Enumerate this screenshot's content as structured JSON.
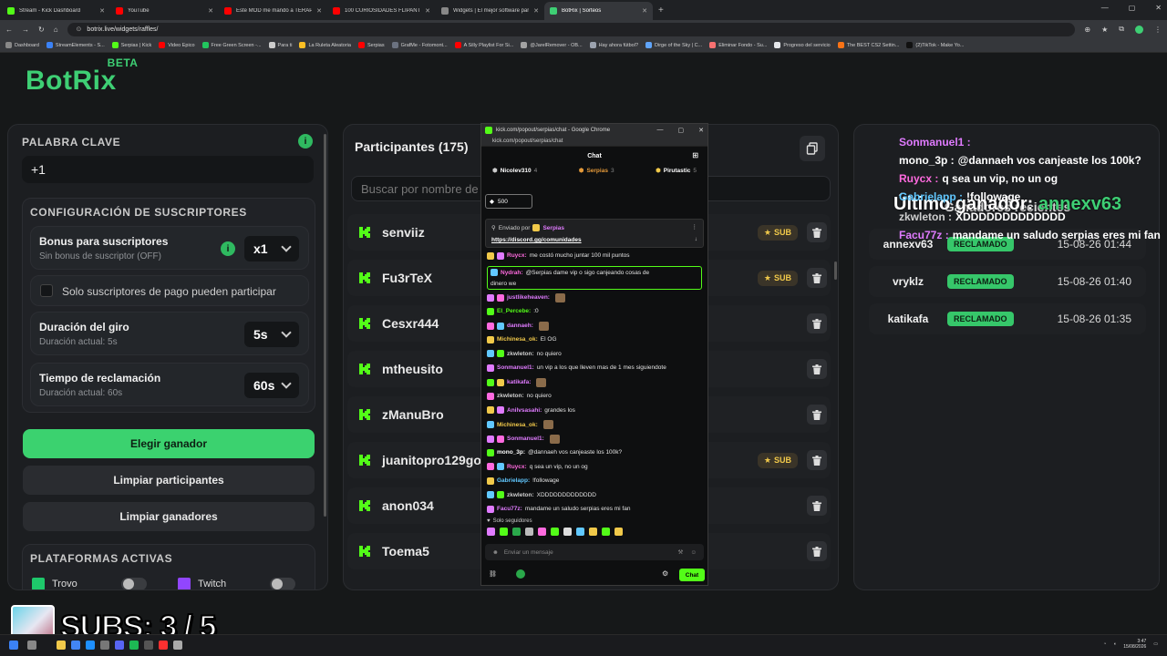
{
  "browser": {
    "tabs": [
      {
        "title": "Stream - Kick Dashboard",
        "color": "#53fc18"
      },
      {
        "title": "YouTube",
        "color": "#ff0000"
      },
      {
        "title": "Este MOD me mandó a TERAPIA",
        "color": "#ff0000"
      },
      {
        "title": "100 CURIOSIDADES FLIPANTES",
        "color": "#ff0000"
      },
      {
        "title": "Widgets | El mejor software par",
        "color": "#888888"
      },
      {
        "title": "BotRix | Sorteos",
        "color": "#3ecf74"
      }
    ],
    "new_tab": "+",
    "url": "botrix.live/widgets/raffles/",
    "bookmarks": [
      "Dashboard",
      "StreamElements - S...",
      "Serpias | Kick",
      "Video Epico",
      "Free Green Screen -...",
      "Para ti",
      "La Ruleta Aleatoria",
      "Serpias",
      "GrafMe - Fotomont...",
      "A Silly Playlist For Si...",
      "@JarelRemover - OB...",
      "Hay ahora fútbol?",
      "Dirge of the Sky | C...",
      "Eliminar Fondo - Su...",
      "Progreso del servicio",
      "The BEST CS2 Settin...",
      "(2)TikTok - Make Yo..."
    ]
  },
  "logo": {
    "name": "BotRix",
    "tag": "BETA"
  },
  "left": {
    "keyword_label": "PALABRA CLAVE",
    "keyword_value": "+1",
    "sub_config_label": "CONFIGURACIÓN DE SUSCRIPTORES",
    "bonus_title": "Bonus para suscriptores",
    "bonus_sub": "Sin bonus de suscriptor (OFF)",
    "bonus_value": "x1",
    "paid_only": "Solo suscriptores de pago pueden participar",
    "spin_title": "Duración del giro",
    "spin_sub": "Duración actual: 5s",
    "spin_value": "5s",
    "claim_title": "Tiempo de reclamación",
    "claim_sub": "Duración actual: 60s",
    "claim_value": "60s",
    "btn_pick": "Elegir ganador",
    "btn_clear_participants": "Limpiar participantes",
    "btn_clear_winners": "Limpiar ganadores",
    "platforms_label": "PLATAFORMAS ACTIVAS",
    "platforms": [
      "Trovo",
      "Twitch"
    ]
  },
  "participants": {
    "title": "Participantes (175)",
    "search_placeholder": "Buscar por nombre de u",
    "sub_label": "SUB",
    "rows": [
      {
        "name": "senviiz",
        "sub": true
      },
      {
        "name": "Fu3rTeX",
        "sub": true
      },
      {
        "name": "Cesxr444",
        "sub": false
      },
      {
        "name": "mtheusito",
        "sub": false
      },
      {
        "name": "zManuBro",
        "sub": false
      },
      {
        "name": "juanitopro129god",
        "sub": true
      },
      {
        "name": "anon034",
        "sub": false
      },
      {
        "name": "Toema5",
        "sub": false
      }
    ]
  },
  "winners": {
    "last_winner_label": "Último ganador:",
    "last_winner": "annexv63",
    "recent_label": "Ganadores recientes",
    "claimed_label": "RECLAMADO",
    "rows": [
      {
        "name": "annexv63",
        "date": "15-08-26 01:44"
      },
      {
        "name": "vryklz",
        "date": "15-08-26 01:40"
      },
      {
        "name": "katikafa",
        "date": "15-08-26 01:35"
      }
    ]
  },
  "overlay_chat": [
    {
      "user": "Sonmanuel1 :",
      "text": "",
      "color": "#e07bff"
    },
    {
      "user": "mono_3p :",
      "text": "@dannaeh vos canjeaste los 100k?",
      "color": "#ffffff"
    },
    {
      "user": "Ruycx :",
      "text": "q sea un vip, no un og",
      "color": "#ff6adf"
    },
    {
      "user": "Gabrielapp :",
      "text": "!followage",
      "color": "#61c8ff"
    },
    {
      "user": "zkwleton :",
      "text": "XDDDDDDDDDDDDD",
      "color": "#cfcfcf"
    },
    {
      "user": "Facu77z :",
      "text": "mandame un saludo serpias eres mi fan",
      "color": "#e07bff"
    }
  ],
  "chat": {
    "window_title": "kick.com/popout/serpias/chat - Google Chrome",
    "url": "kick.com/popout/serpias/chat",
    "header": "Chat",
    "leaders": [
      {
        "name": "Nicolev310",
        "n": "4"
      },
      {
        "name": "Serpias",
        "n": "3"
      },
      {
        "name": "Pirutastic",
        "n": "5"
      }
    ],
    "points": "500",
    "pinned_by": "Enviado por",
    "pinned_user": "Serpias",
    "pinned_link": "https://discord.gg/comunidades",
    "messages": [
      {
        "user": "Ruycx:",
        "text": "me costó mucho juntar 100 mil puntos",
        "color": "#ff6adf"
      },
      {
        "user": "Nydrah:",
        "text": "@Serpias dame vip o sigo canjeando cosas de",
        "text2": "dinero we",
        "color": "#ff6adf"
      },
      {
        "user": "justlikeheaven:",
        "text": "",
        "color": "#e07bff"
      },
      {
        "user": "El_Percebe:",
        "text": ":0",
        "color": "#53fc18"
      },
      {
        "user": "dannaeh:",
        "text": "",
        "color": "#e07bff"
      },
      {
        "user": "Michinesa_ok:",
        "text": "El OG",
        "color": "#f1c94a"
      },
      {
        "user": "zkwleton:",
        "text": "no quiero",
        "color": "#cfcfcf"
      },
      {
        "user": "Sonmanuel1:",
        "text": "un vip a los que lleven mas de 1 mes siguiendote",
        "color": "#e07bff"
      },
      {
        "user": "katikafa:",
        "text": "",
        "color": "#e07bff"
      },
      {
        "user": "zkwleton:",
        "text": "no quiero",
        "color": "#cfcfcf"
      },
      {
        "user": "Anilvsasahi:",
        "text": "grandes los",
        "color": "#e07bff"
      },
      {
        "user": "Michinesa_ok:",
        "text": "",
        "color": "#f1c94a"
      },
      {
        "user": "Sonmanuel1:",
        "text": "",
        "color": "#e07bff"
      },
      {
        "user": "mono_3p:",
        "text": "@dannaeh vos canjeaste los 100k?",
        "color": "#ffffff"
      },
      {
        "user": "Ruycx:",
        "text": "q sea un vip, no un og",
        "color": "#ff6adf"
      },
      {
        "user": "Gabrielapp:",
        "text": "!followage",
        "color": "#61c8ff"
      },
      {
        "user": "zkwleton:",
        "text": "XDDDDDDDDDDDDD",
        "color": "#cfcfcf"
      },
      {
        "user": "Facu77z:",
        "text": "mandame un saludo serpias eres mi fan",
        "color": "#e07bff"
      }
    ],
    "followers_only": "Solo seguidores",
    "input_placeholder": "Enviar un mensaje",
    "send_label": "Chat"
  },
  "subs_overlay": "SUBS: 3 / 5",
  "taskbar": {
    "time": "3:47",
    "date": "15/08/2026"
  }
}
